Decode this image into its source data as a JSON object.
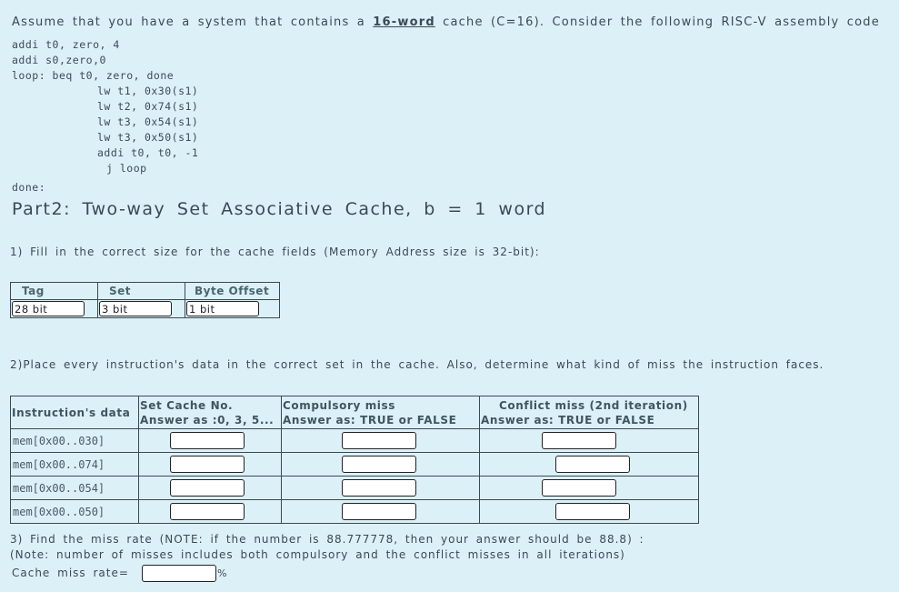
{
  "intro": {
    "before": "Assume that you have a system that contains a ",
    "highlight": "16-word",
    "after": " cache (C=16). Consider the following RISC-V assembly code"
  },
  "code": {
    "lines": [
      "addi  t0, zero, 4",
      "addi  s0,zero,0",
      "loop: beq   t0, zero, done",
      "lw     t1, 0x30(s1)",
      "lw     t2, 0x74(s1)",
      "lw     t3, 0x54(s1)",
      "lw   t3, 0x50(s1)",
      "addi  t0, t0, -1",
      "j      loop",
      "done:"
    ]
  },
  "part_title": "Part2: Two-way Set Associative Cache, b = 1 word",
  "q1": {
    "prompt": "1) Fill in the correct size for the cache fields (Memory Address size is 32-bit):",
    "headers": [
      "Tag",
      "Set",
      "Byte Offset"
    ],
    "values": [
      "28 bit",
      "3 bit",
      "1 bit"
    ]
  },
  "q2": {
    "prompt": "2)Place every instruction's data in the correct set in the cache. Also, determine what kind of miss the instruction faces.",
    "headers": {
      "col1": "Instruction's data",
      "col2_line1": "Set Cache No.",
      "col2_line2": "Answer as :0, 3, 5...",
      "col3_line1": "Compulsory miss",
      "col3_line2": "Answer as: TRUE or FALSE",
      "col4_line1": "Conflict miss (2nd iteration)",
      "col4_line2": "Answer as: TRUE or FALSE"
    },
    "rows": [
      {
        "label": "mem[0x00..030]",
        "set": "",
        "compulsory": "",
        "conflict": ""
      },
      {
        "label": "mem[0x00..074]",
        "set": "",
        "compulsory": "",
        "conflict": ""
      },
      {
        "label": "mem[0x00..054]",
        "set": "",
        "compulsory": "",
        "conflict": ""
      },
      {
        "label": "mem[0x00..050]",
        "set": "",
        "compulsory": "",
        "conflict": ""
      }
    ]
  },
  "q3": {
    "line1": "3) Find the miss rate  (NOTE: if the number is 88.777778, then your answer should be 88.8) :",
    "line2": "(Note:  number of misses includes both compulsory and the conflict misses in all iterations)",
    "label": "Cache miss rate=",
    "value": "",
    "unit": "%"
  }
}
